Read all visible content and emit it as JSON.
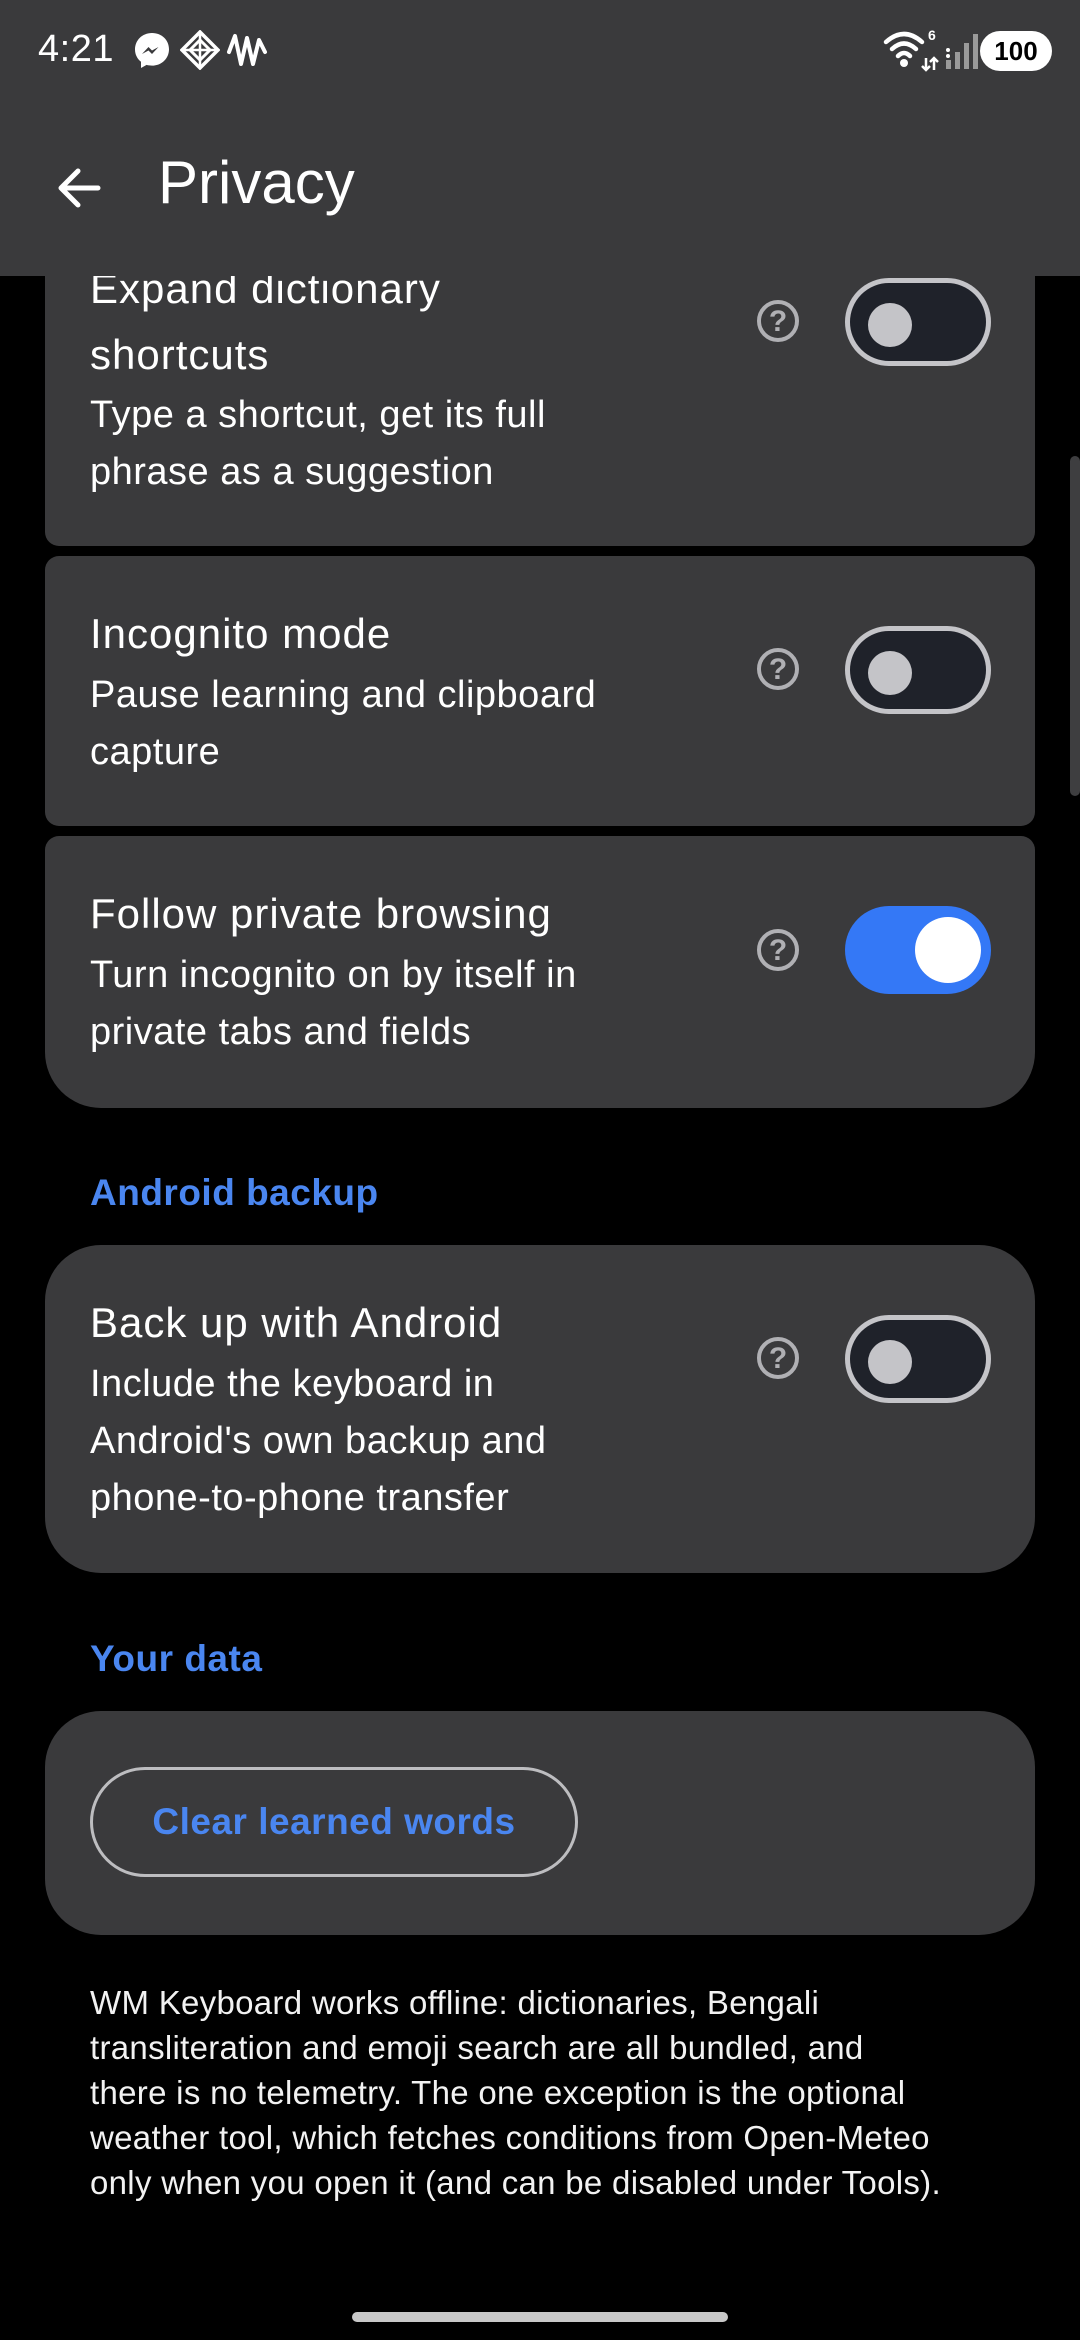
{
  "status": {
    "time": "4:21",
    "icons": [
      "messenger-icon",
      "diamond-app-icon",
      "waveform-icon",
      "wifi-icon",
      "signal-icon"
    ],
    "wifi_badge": "6",
    "battery": "100"
  },
  "appbar": {
    "title": "Privacy",
    "back_icon": "arrow-left-icon"
  },
  "settings": [
    {
      "title_lines": [
        "Expand dictionary",
        "shortcuts"
      ],
      "desc_lines": [
        "Type a shortcut, get its full",
        "phrase as a suggestion"
      ],
      "enabled": false
    },
    {
      "title_lines": [
        "Incognito mode"
      ],
      "desc_lines": [
        "Pause learning and clipboard",
        "capture"
      ],
      "enabled": false
    },
    {
      "title_lines": [
        "Follow private browsing"
      ],
      "desc_lines": [
        "Turn incognito on by itself in",
        "private tabs and fields"
      ],
      "enabled": true
    },
    {
      "title_lines": [
        "Back up with Android"
      ],
      "desc_lines": [
        "Include the keyboard in",
        "Android's own backup and",
        "phone-to-phone transfer"
      ],
      "enabled": false
    }
  ],
  "help_glyph": "?",
  "sections": {
    "backup": "Android backup",
    "data": "Your data"
  },
  "clear_button": "Clear learned words",
  "footer_lines": [
    "WM Keyboard works offline: dictionaries, Bengali",
    "transliteration and emoji search are all bundled, and",
    "there is no telemetry. The one exception is the optional",
    "weather tool, which fetches conditions from Open-Meteo",
    "only when you open it (and can be disabled under Tools)."
  ],
  "colors": {
    "accent": "#4a86f0",
    "toggle_on": "#3478f6",
    "card": "#3a3a3c",
    "background": "#000000"
  }
}
